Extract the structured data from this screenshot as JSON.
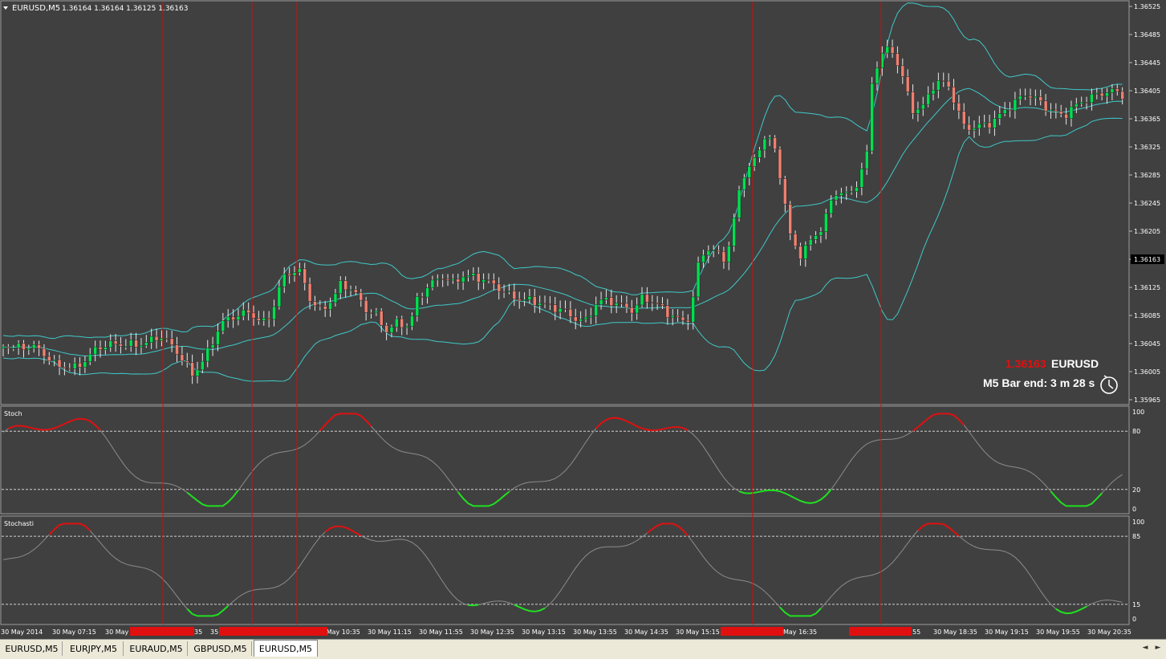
{
  "window": {
    "symbol_label": "EURUSD,M5",
    "ohlc": "1.36164 1.36164 1.36125 1.36163"
  },
  "info_box": {
    "price": "1.36163",
    "symbol": "EURUSD",
    "bar_end": "M5 Bar end: 3 m 28 s",
    "icon": "clock-icon"
  },
  "price_axis": {
    "labels": [
      "1.36525",
      "1.36485",
      "1.36445",
      "1.36405",
      "1.36365",
      "1.36325",
      "1.36285",
      "1.36245",
      "1.36205",
      "1.36163",
      "1.36125",
      "1.36085",
      "1.36045",
      "1.36005",
      "1.35965"
    ],
    "current": "1.36163"
  },
  "stoch1": {
    "name": "Stoch",
    "levels": [
      {
        "label": "100",
        "v": 100
      },
      {
        "label": "80",
        "v": 80
      },
      {
        "label": "20",
        "v": 20
      },
      {
        "label": "0",
        "v": 0
      }
    ]
  },
  "stoch2": {
    "name": "Stochasti",
    "levels": [
      {
        "label": "100",
        "v": 100
      },
      {
        "label": "85",
        "v": 85
      },
      {
        "label": "15",
        "v": 15
      },
      {
        "label": "0",
        "v": 0
      }
    ]
  },
  "time_axis": {
    "labels": [
      "30 May 2014",
      "30 May 07:15",
      "30 May",
      "30 May 10:35",
      "30 May 11:15",
      "30 May 11:55",
      "30 May 12:35",
      "30 May 13:15",
      "30 May 13:55",
      "30 May 14:35",
      "30 May 15:15",
      "May 16:35",
      "30 May 18:35",
      "30 May 19:15",
      "30 May 19:55",
      "30 May 20:35"
    ],
    "time_fragments": [
      "35",
      "55"
    ]
  },
  "colors": {
    "background": "#404040",
    "bull": "#00E050",
    "bear": "#F08070",
    "bands": "#40C8C8",
    "vline": "#C81010",
    "signal_red": "#E01010",
    "signal_green": "#20E020",
    "axis_label_bg": "#000000"
  },
  "tabs": [
    {
      "label": "EURUSD,M5",
      "active": false
    },
    {
      "label": "EURJPY,M5",
      "active": false
    },
    {
      "label": "EURAUD,M5",
      "active": false
    },
    {
      "label": "GBPUSD,M5",
      "active": false
    },
    {
      "label": "EURUSD,M5",
      "active": true
    }
  ],
  "tab_scroll": {
    "left": "◄",
    "right": "►"
  }
}
